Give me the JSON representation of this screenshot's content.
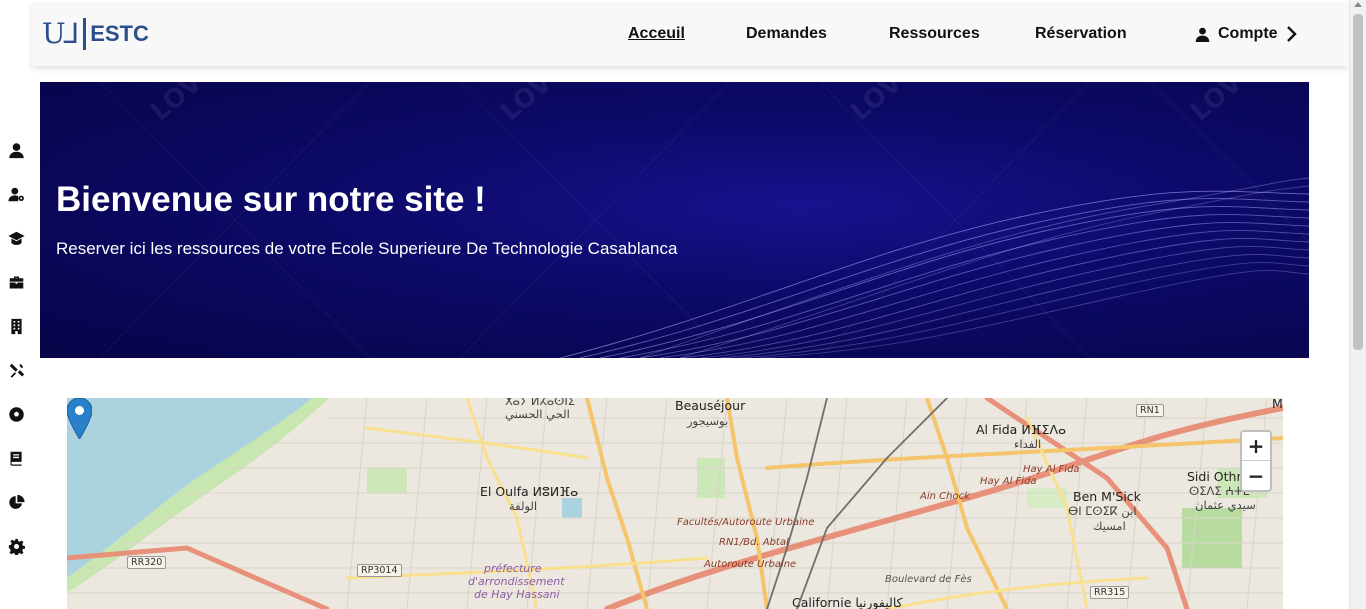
{
  "logo": {
    "mark": "U⅃",
    "text": "ESTC"
  },
  "nav": {
    "links": [
      {
        "label": "Acceuil",
        "active": true
      },
      {
        "label": "Demandes"
      },
      {
        "label": "Ressources"
      },
      {
        "label": "Réservation"
      }
    ],
    "account": {
      "label": "Compte",
      "icon": "user-icon"
    }
  },
  "sidebar": {
    "icons": [
      "user-icon",
      "user-cog-icon",
      "graduation-cap-icon",
      "briefcase-icon",
      "building-icon",
      "tools-icon",
      "football-icon",
      "book-icon",
      "pie-chart-icon",
      "gear-icon"
    ]
  },
  "hero": {
    "title": "Bienvenue sur notre site !",
    "subtitle": "Reserver ici les ressources de votre Ecole Superieure De Technologie Casablanca",
    "watermark": "LOV lovepik"
  },
  "map": {
    "zoom_in": "+",
    "zoom_out": "−",
    "labels": {
      "l1": "ⵅⴰⵢ ⵍⵃⴰⵙⵏⵉ",
      "l2": "الحي الحسني",
      "beausejour": "Beauséjour",
      "beausejour_ar": "بوسيجور",
      "alfida": "Al Fida ⵍⴼⵉⴷⴰ",
      "alfida_ar": "الفداء",
      "rn1": "RN1",
      "sidi": "Sidi Othm",
      "sidi_tf": "ⵙⵉⴷⵉ ⵄⵜⵎ",
      "sidi_ar": "سيدي عثمان",
      "eloulfa": "El Oulfa ⵍⵓⵍⴼⴰ",
      "eloulfa_ar": "الولفة",
      "hayalfida1": "Hay Al Fida",
      "hayalfida2": "Hay Al Fida",
      "ainchock": "Ain Chock",
      "benmsick": "Ben M'Sick",
      "benmsick_tf": "ⴱⵏ ⵎⵙⵉⴽ ابن",
      "benmsick_ar": "امسيك",
      "facultes": "Facultés/Autoroute Urbaine",
      "rn1bd": "RN1/Bd. Abtal",
      "autoroute": "Autoroute Urbaine",
      "rr320": "RR320",
      "rp3014": "RP3014",
      "prefecture1": "préfecture",
      "prefecture2": "d'arrondissement",
      "prefecture3": "de Hay Hassani",
      "bdfes": "Boulevard de Fès",
      "californie": "Californie كاليفورنيا",
      "rr315": "RR315",
      "m": "M"
    }
  }
}
